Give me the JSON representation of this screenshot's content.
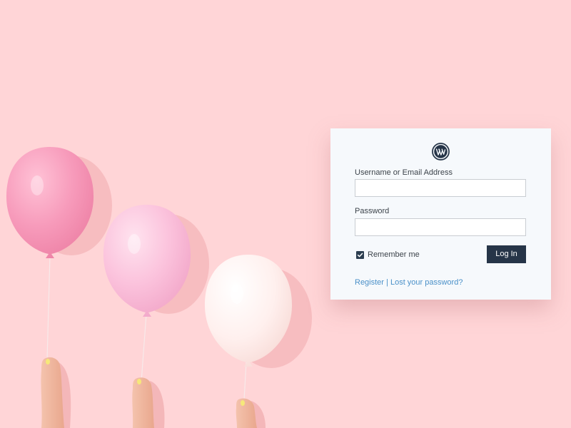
{
  "colors": {
    "background": "#ffd5d7",
    "card": "#f6f9fc",
    "button": "#263548",
    "link": "#4a90c8"
  },
  "logo": {
    "icon": "wordpress-icon"
  },
  "form": {
    "username_label": "Username or Email Address",
    "username_value": "",
    "password_label": "Password",
    "password_value": "",
    "remember_label": "Remember me",
    "remember_checked": true,
    "submit_label": "Log In"
  },
  "links": {
    "register": "Register",
    "separator": " | ",
    "lost_password": "Lost your password?"
  }
}
